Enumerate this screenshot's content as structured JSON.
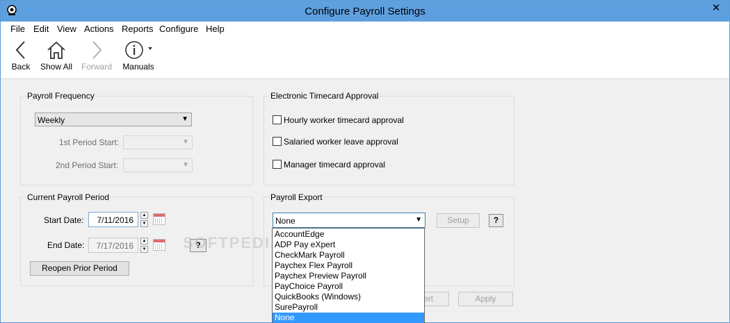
{
  "window": {
    "title": "Configure Payroll Settings",
    "close_glyph": "✕",
    "title_bar_color": "#5e9fe0"
  },
  "menu": [
    "File",
    "Edit",
    "View",
    "Actions",
    "Reports",
    "Configure",
    "Help"
  ],
  "toolbar": {
    "back": "Back",
    "show_all": "Show All",
    "forward": "Forward",
    "manuals": "Manuals"
  },
  "payroll_frequency": {
    "legend": "Payroll Frequency",
    "frequency_value": "Weekly",
    "first_period_label": "1st Period Start:",
    "second_period_label": "2nd Period Start:"
  },
  "timecard": {
    "legend": "Electronic Timecard Approval",
    "options": [
      {
        "label": "Hourly worker timecard approval",
        "checked": false
      },
      {
        "label": "Salaried worker leave approval",
        "checked": false
      },
      {
        "label": "Manager timecard approval",
        "checked": false
      }
    ]
  },
  "current_period": {
    "legend": "Current Payroll Period",
    "start_label": "Start Date:",
    "start_value": "7/11/2016",
    "end_label": "End Date:",
    "end_value": "7/17/2016",
    "help": "?",
    "reopen": "Reopen Prior Period"
  },
  "export": {
    "legend": "Payroll Export",
    "selected": "None",
    "setup": "Setup",
    "help": "?",
    "options": [
      "AccountEdge",
      "ADP Pay eXpert",
      "CheckMark Payroll",
      "Paychex Flex Payroll",
      "Paychex Preview Payroll",
      "PayChoice Payroll",
      "QuickBooks (Windows)",
      "SurePayroll",
      "None"
    ],
    "highlighted": "None"
  },
  "footer": {
    "revert_partial": "ert",
    "apply": "Apply"
  },
  "watermark": "SOFTPEDIA",
  "icons": {
    "app": "payroll-app-icon",
    "back": "chevron-left-icon",
    "home": "home-icon",
    "forward": "chevron-right-icon",
    "info": "info-icon",
    "calendar": "calendar-icon"
  },
  "colors": {
    "selection": "#3399ff",
    "focus_border": "#3c7fb1"
  }
}
